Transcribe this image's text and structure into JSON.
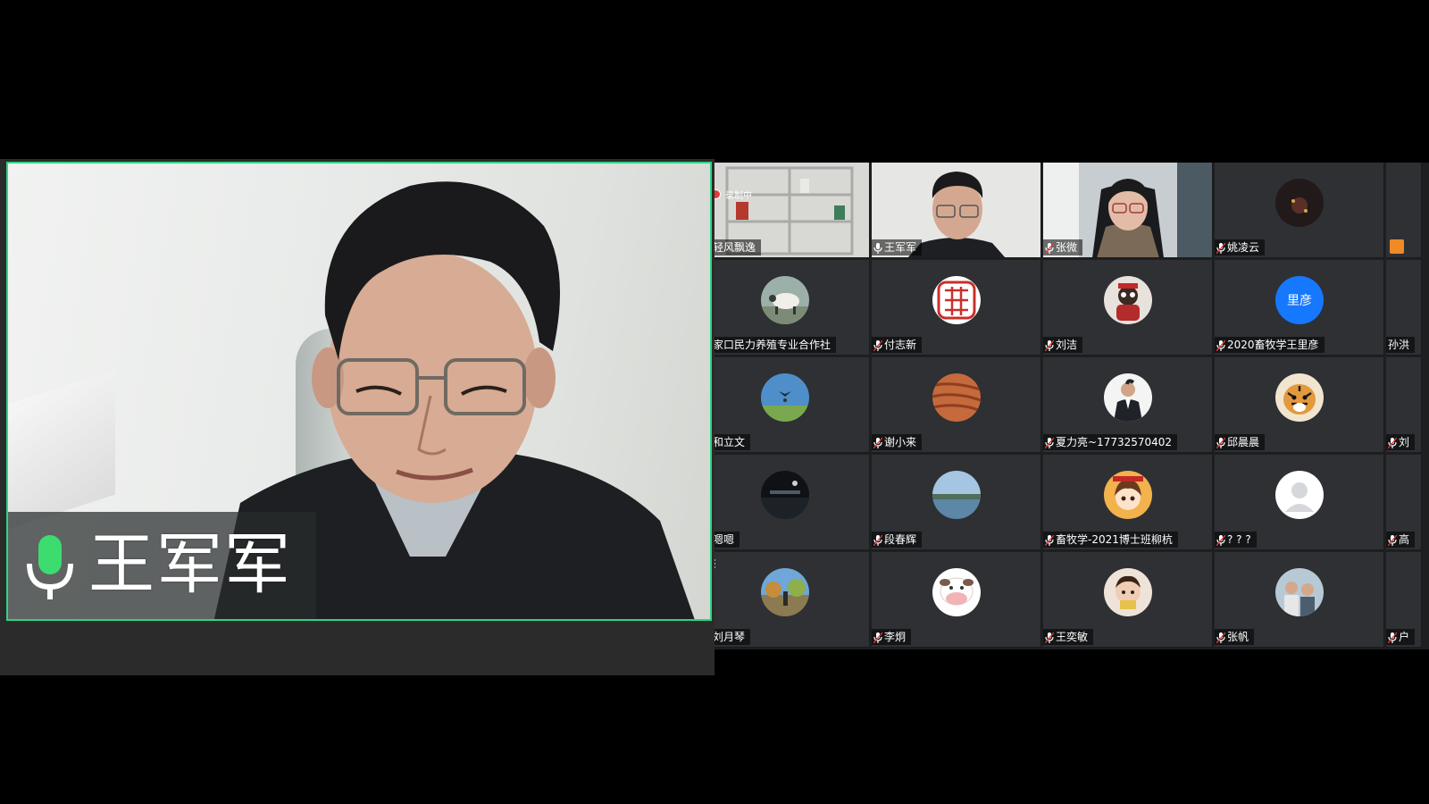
{
  "speaker": {
    "name": "王军军"
  },
  "gallery": {
    "recording_label": "录制中",
    "tiles": [
      {
        "name": "轻风飘逸",
        "kind": "video-room",
        "col": 0,
        "row": 0
      },
      {
        "name": "王军军",
        "kind": "video-man",
        "col": 1,
        "row": 0
      },
      {
        "name": "张微",
        "kind": "video-woman",
        "col": 2,
        "row": 0
      },
      {
        "name": "姚凌云",
        "kind": "avatar",
        "avatar": "dark-scene",
        "col": 3,
        "row": 0
      },
      {
        "name": "",
        "kind": "partial",
        "col": 4,
        "row": 0
      },
      {
        "name": "张家口民力养殖专业合作社",
        "kind": "avatar",
        "avatar": "sheep",
        "col": 0,
        "row": 1,
        "nomic": true
      },
      {
        "name": "付志新",
        "kind": "avatar",
        "avatar": "seal",
        "col": 1,
        "row": 1
      },
      {
        "name": "刘洁",
        "kind": "avatar",
        "avatar": "toy",
        "col": 2,
        "row": 1
      },
      {
        "name": "2020畜牧学王里彦",
        "kind": "avatar",
        "avatar": "blue-text",
        "avatar_text": "里彦",
        "col": 3,
        "row": 1
      },
      {
        "name": "孙洪",
        "kind": "partial",
        "col": 4,
        "row": 1,
        "nomic": true
      },
      {
        "name": "和立文",
        "kind": "avatar",
        "avatar": "sky",
        "col": 0,
        "row": 2
      },
      {
        "name": "谢小来",
        "kind": "avatar",
        "avatar": "canyon",
        "col": 1,
        "row": 2
      },
      {
        "name": "夏力亮~17732570402",
        "kind": "avatar",
        "avatar": "suit",
        "col": 2,
        "row": 2
      },
      {
        "name": "邱晨晨",
        "kind": "avatar",
        "avatar": "tiger",
        "col": 3,
        "row": 2
      },
      {
        "name": "刘",
        "kind": "partial",
        "col": 4,
        "row": 2
      },
      {
        "name": "嗯嗯",
        "kind": "avatar",
        "avatar": "night",
        "col": 0,
        "row": 3
      },
      {
        "name": "段春辉",
        "kind": "avatar",
        "avatar": "river",
        "col": 1,
        "row": 3
      },
      {
        "name": "畜牧学-2021博士班柳杭",
        "kind": "avatar",
        "avatar": "anime",
        "col": 2,
        "row": 3
      },
      {
        "name": "? ? ?",
        "kind": "avatar",
        "avatar": "default",
        "col": 3,
        "row": 3
      },
      {
        "name": "高",
        "kind": "partial",
        "col": 4,
        "row": 3
      },
      {
        "name": "刘月琴",
        "kind": "avatar",
        "avatar": "park",
        "col": 0,
        "row": 4
      },
      {
        "name": "李炯",
        "kind": "avatar",
        "avatar": "cow",
        "col": 1,
        "row": 4
      },
      {
        "name": "王奕敏",
        "kind": "avatar",
        "avatar": "child",
        "col": 2,
        "row": 4
      },
      {
        "name": "张帆",
        "kind": "avatar",
        "avatar": "people",
        "col": 3,
        "row": 4
      },
      {
        "name": "户",
        "kind": "partial",
        "col": 4,
        "row": 4
      }
    ]
  },
  "colors": {
    "active_speaker_border": "#2fd483",
    "mic_green": "#3ddc6f",
    "tile_bg": "#2e3033",
    "recording_red": "#e03a3a",
    "avatar_blue": "#1677ff"
  }
}
